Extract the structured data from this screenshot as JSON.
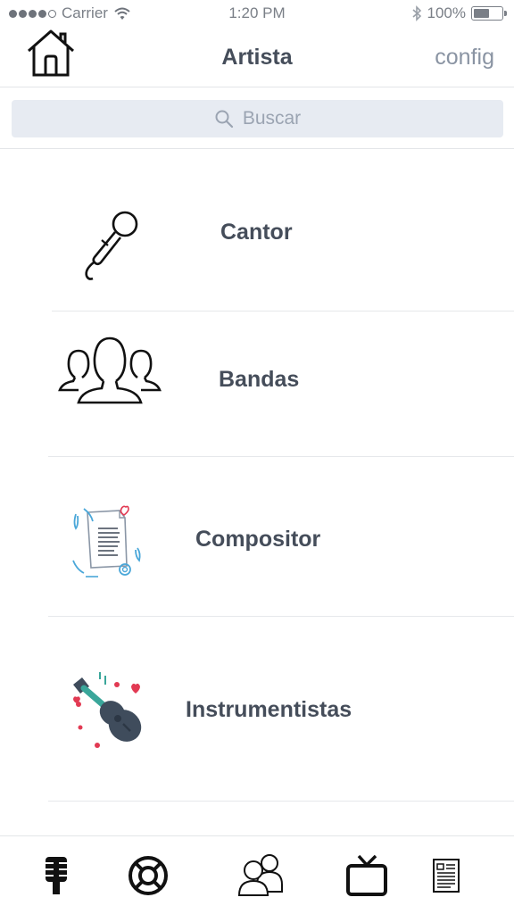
{
  "status_bar": {
    "carrier": "Carrier",
    "time": "1:20 PM",
    "battery": "100%",
    "signal_icon": "signal-dots-icon",
    "wifi_icon": "wifi-icon",
    "bluetooth_icon": "bluetooth-icon",
    "battery_icon": "battery-icon"
  },
  "nav": {
    "title": "Artista",
    "config_label": "config",
    "home_icon": "home-icon"
  },
  "search": {
    "placeholder": "Buscar",
    "icon": "search-icon"
  },
  "categories": [
    {
      "label": "Cantor",
      "icon": "microphone-icon"
    },
    {
      "label": "Bandas",
      "icon": "group-icon"
    },
    {
      "label": "Compositor",
      "icon": "sheet-music-icon"
    },
    {
      "label": "Instrumentistas",
      "icon": "guitar-icon"
    }
  ],
  "tabs": [
    {
      "icon": "microphone-tab-icon"
    },
    {
      "icon": "lifebuoy-tab-icon"
    },
    {
      "icon": "people-tab-icon"
    },
    {
      "icon": "tv-tab-icon"
    },
    {
      "icon": "document-tab-icon"
    }
  ],
  "colors": {
    "text": "#454d5a",
    "link": "#8a94a3",
    "search_bg": "#e7ebf2",
    "accent_blue": "#4aa7d9",
    "accent_red": "#e23a53",
    "guitar": "#3f4c5c",
    "guitar_neck": "#3aa69a"
  }
}
